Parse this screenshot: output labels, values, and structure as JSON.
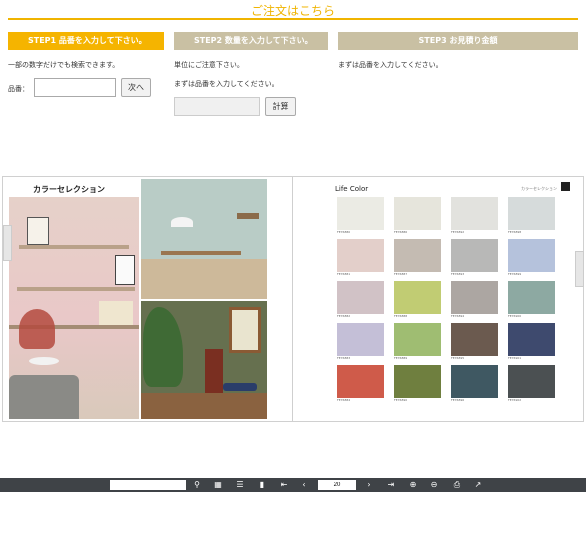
{
  "header": {
    "title": "ご注文はこちら",
    "accent": "#f0b400"
  },
  "steps": {
    "step1": {
      "label": "STEP1 品番を入力して下さい。",
      "note": "一部の数字だけでも検索できます。",
      "field_label": "品番：",
      "field_value": "",
      "next_button": "次へ"
    },
    "step2": {
      "label": "STEP2 数量を入力して下さい。",
      "note1": "単位にご注意下さい。",
      "note2": "まずは品番を入力してください。",
      "qty_value": "",
      "calc_button": "計算"
    },
    "step3": {
      "label": "STEP3 お見積り金額",
      "note": "まずは品番を入力してください。"
    }
  },
  "catalog": {
    "left_title": "カラーセレクション",
    "right_title": "Life Color",
    "right_subtitle": "カラーセレクション",
    "swatches": [
      {
        "color": "#ebebe4",
        "code": "FE76880"
      },
      {
        "color": "#e6e5dc",
        "code": "FE76886"
      },
      {
        "color": "#e2e2de",
        "code": "FE76892"
      },
      {
        "color": "#d6dbdb",
        "code": "FE76898"
      },
      {
        "color": "#e3cfca",
        "code": "FE76881"
      },
      {
        "color": "#c4bbb2",
        "code": "FE76887"
      },
      {
        "color": "#b8b8b7",
        "code": "FE76893"
      },
      {
        "color": "#b5c2dc",
        "code": "FE76899"
      },
      {
        "color": "#d1c2c6",
        "code": "FE76882"
      },
      {
        "color": "#c1cc73",
        "code": "FE76888"
      },
      {
        "color": "#aca6a2",
        "code": "FE76894"
      },
      {
        "color": "#8da9a2",
        "code": "FE76900"
      },
      {
        "color": "#c4bfd7",
        "code": "FE76883"
      },
      {
        "color": "#9fbd72",
        "code": "FE76889"
      },
      {
        "color": "#6b5a4f",
        "code": "FE76895"
      },
      {
        "color": "#3e4a6e",
        "code": "FE76901"
      },
      {
        "color": "#cf5b4a",
        "code": "FE76884"
      },
      {
        "color": "#6f7f3f",
        "code": "FE76890"
      },
      {
        "color": "#3f5862",
        "code": "FE76896"
      },
      {
        "color": "#4b5052",
        "code": "FE76902"
      }
    ]
  },
  "toolbar": {
    "search_value": "",
    "page_value": "20",
    "icons": [
      "search-icon",
      "thumbnails-icon",
      "list-icon",
      "bookmark-icon",
      "first-page-icon",
      "prev-page-icon",
      "next-page-icon",
      "last-page-icon",
      "zoom-in-icon",
      "zoom-out-icon",
      "print-icon",
      "share-icon"
    ]
  }
}
